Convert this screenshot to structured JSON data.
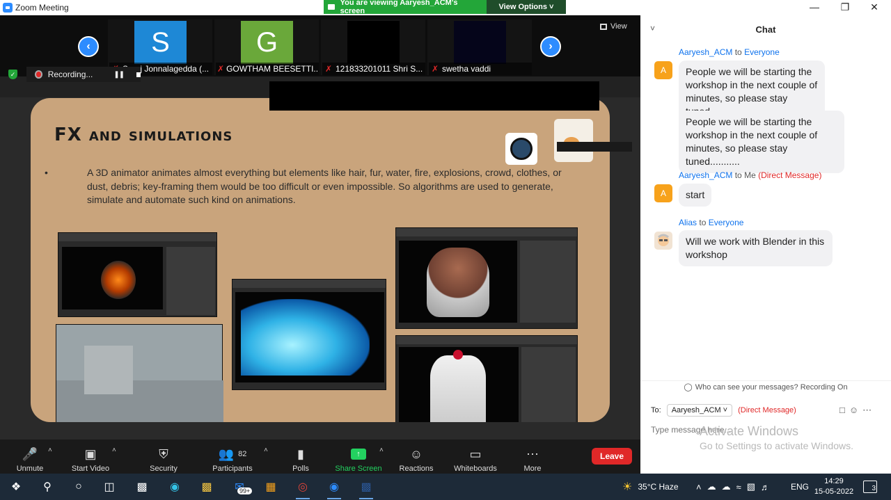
{
  "window": {
    "title": "Zoom Meeting",
    "banner_text": "You are viewing Aaryesh_ACM's screen",
    "view_options": "View Options ˅"
  },
  "filmstrip": {
    "participants": [
      {
        "initial": "S",
        "name": "Suraj Jonnalagedda (...",
        "color": "#1e88d6"
      },
      {
        "initial": "G",
        "name": "GOWTHAM BEESETTI...",
        "color": "#6aa83a"
      },
      {
        "initial": "",
        "name": "121833201011 Shri S...",
        "color": "#000000"
      },
      {
        "initial": "",
        "name": "swetha vaddi",
        "color": "#05051a"
      }
    ],
    "view_label": "View"
  },
  "recording": {
    "label": "Recording..."
  },
  "slide": {
    "title": "FX and simulations",
    "bullet": "A 3D animator animates almost everything but elements like hair, fur, water, fire, explosions, crowd, clothes, or dust, debris; key-framing them would be too difficult or even impossible. So algorithms are used to generate, simulate and automate such kind on animations."
  },
  "toolbar": {
    "unmute": "Unmute",
    "start_video": "Start Video",
    "security": "Security",
    "participants": "Participants",
    "participants_count": "82",
    "polls": "Polls",
    "share_screen": "Share Screen",
    "reactions": "Reactions",
    "whiteboards": "Whiteboards",
    "more": "More",
    "leave": "Leave"
  },
  "chat": {
    "title": "Chat",
    "messages": [
      {
        "from": "Aaryesh_ACM",
        "to_word": "to",
        "to": "Everyone",
        "avatar": "A",
        "text1": "People we will be starting the workshop in the next couple of minutes, so please stay tuned...",
        "text2": "People we will be starting the workshop in the next couple of minutes, so please stay tuned..........."
      },
      {
        "from": "Aaryesh_ACM",
        "to_word": "to",
        "to": "Me",
        "dm": "(Direct Message)",
        "avatar": "A",
        "text": "start"
      },
      {
        "from": "Alias",
        "to_word": "to",
        "to": "Everyone",
        "text": "Will we work with Blender in this workshop"
      }
    ],
    "who_can_see": "Who can see your messages? Recording On",
    "to_label": "To:",
    "to_recipient": "Aaryesh_ACM ˅",
    "to_dm": "(Direct Message)",
    "input_placeholder": "Type message here...",
    "activate_line1": "Activate Windows",
    "activate_line2": "Go to Settings to activate Windows."
  },
  "taskbar": {
    "weather": "35°C  Haze",
    "lang": "ENG",
    "time": "14:29",
    "date": "15-05-2022",
    "mail_badge": "99+",
    "notifications": "3"
  }
}
